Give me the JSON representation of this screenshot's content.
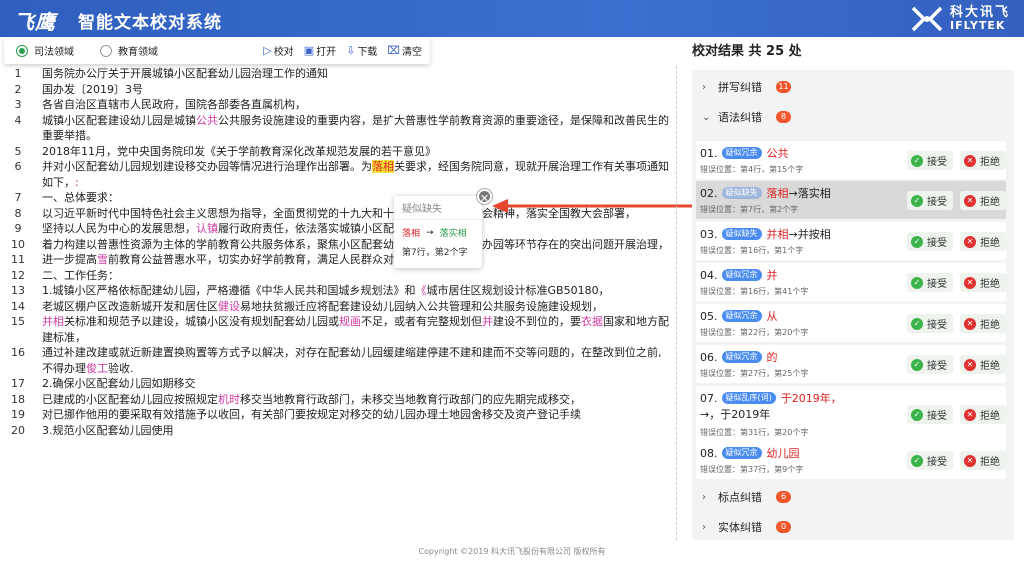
{
  "app": {
    "logo": "飞鹰",
    "title": "智能文本校对系统",
    "brand_cn": "科大讯飞",
    "brand_en": "IFLYTEK"
  },
  "toolbar": {
    "domain1": "司法领域",
    "domain2": "教育领域",
    "proofread": "校对",
    "open": "打开",
    "download": "下载",
    "clear": "清空"
  },
  "doc": {
    "lines": [
      {
        "n": "1",
        "html": "国务院办公厅关于开展城镇小区配套幼儿园治理工作的通知"
      },
      {
        "n": "2",
        "html": "国办发〔2019〕3号"
      },
      {
        "n": "3",
        "html": "各省自治区直辖市人民政府，国院各部委各直属机构，"
      },
      {
        "n": "4",
        "html": "城镇小区配套建设幼儿园是城镇<span class='p'>公共</span>公共服务设施建设的重要内容，是扩大普惠性学前教育资源的重要途径，是保障和改善民生的重要举措。"
      },
      {
        "n": "5",
        "html": "2018年11月，党中央国务院印发《关于学前教育深化改革规范发展的若干意见》"
      },
      {
        "n": "6",
        "html": "并对小区配套幼儿园规划建设移交办园等情况进行治理作出部署。为<span class='hl'>落相</span>关要求，经国务院同意，现就开展治理工作有关事项通知如下，<span class='r'>:</span>"
      },
      {
        "n": "7",
        "html": "一、总体要求："
      },
      {
        "n": "8",
        "html": "以习近平新时代中国特色社会主义思想为指导，全面贯彻党的十九大和十九届二中、三中全会精神，落实全国教大会部署，"
      },
      {
        "n": "9",
        "html": "坚持以人民为中心的发展思想，<span class='p'>认镇</span>履行政府责任，依法落实城镇小区配套幼儿园"
      },
      {
        "n": "10",
        "html": "着力构建以普惠性资源为主体的学前教育公共服务体系，聚焦小区配套幼儿园规划建设移交办园等环节存在的突出问题开展治理，"
      },
      {
        "n": "11",
        "html": "进一步提高<span class='p'>雪</span>前教育公益普惠水平，切实办好学前教育，满足人民群众对幼有所育的期盼。"
      },
      {
        "n": "12",
        "html": "二、工作任务："
      },
      {
        "n": "13",
        "html": "1.城镇小区严格依标配建幼儿园，严格遵循《中华人民共和国城乡规划法》和<span class='p'>《</span>城市居住区规划设计标准GB50180，"
      },
      {
        "n": "14",
        "html": "老城区棚户区改造新城开发和居住区<span class='p'>健设</span>易地扶贫搬迁应将配套建设幼儿园纳入公共管理和公共服务设施建设规划，"
      },
      {
        "n": "15",
        "html": "<span class='p'>并相</span>关标准和规范予以建设，城镇小区没有规划配套幼儿园或<span class='p'>规画</span>不足，或者有完整规划但<span class='p'>并</span>建设不到位的，要<span class='p'>衣据</span>国家和地方配建标准，"
      },
      {
        "n": "16",
        "html": "通过补建改建或就近新建置换购置等方式予以解决，对存在配套幼儿园缓建缩建停建不建和建而不交等问题的，在整改到位之前,不得办理<span class='p'>俊工</span>验收."
      },
      {
        "n": "17",
        "html": "2.确保小区配套幼儿园如期移交"
      },
      {
        "n": "18",
        "html": "已建成的小区配套幼儿园应按照规定<span class='p'>机时</span>移交当地教育行政部门，未移交当地教育行政部门的应先期完成移交，"
      },
      {
        "n": "19",
        "html": "对已挪作他用的要采取有效措施予以收回，有关部门要按规定对移交的幼儿园办理土地园舍移交及资产登记手续"
      },
      {
        "n": "20",
        "html": "3.规范小区配套幼儿园使用"
      }
    ]
  },
  "popup": {
    "title": "疑似缺失",
    "wrong": "落相",
    "arrow": "→",
    "right": "落实相",
    "pos": "第7行，第2个字"
  },
  "results": {
    "header": "校对结果 共 25 处",
    "sections": [
      {
        "label": "拼写纠错",
        "count": "11",
        "chev": "›"
      },
      {
        "label": "语法纠错",
        "count": "8",
        "chev": "⌄"
      },
      {
        "label": "标点纠错",
        "count": "6",
        "chev": "›"
      },
      {
        "label": "实体纠错",
        "count": "0",
        "chev": "›"
      }
    ],
    "accept": "接受",
    "reject": "拒绝",
    "items": [
      {
        "num": "01.",
        "tag": "疑似冗余",
        "wrong": "公共",
        "fix": "",
        "pos": "错误位置：第4行，第15个字"
      },
      {
        "num": "02.",
        "tag": "疑似缺失",
        "wrong": "落相",
        "fix": "→落实相",
        "pos": "错误位置：第7行，第2个字"
      },
      {
        "num": "03.",
        "tag": "疑似缺失",
        "wrong": "并相",
        "fix": "→并按相",
        "pos": "错误位置：第16行，第1个字"
      },
      {
        "num": "04.",
        "tag": "疑似冗余",
        "wrong": "并",
        "fix": "",
        "pos": "错误位置：第16行，第41个字"
      },
      {
        "num": "05.",
        "tag": "疑似冗余",
        "wrong": "从",
        "fix": "",
        "pos": "错误位置：第22行，第20个字"
      },
      {
        "num": "06.",
        "tag": "疑似冗余",
        "wrong": "的",
        "fix": "",
        "pos": "错误位置：第27行，第25个字"
      },
      {
        "num": "07.",
        "tag": "疑似乱序(词)",
        "wrong": "于2019年，",
        "fix": "→，于2019年",
        "pos": "错误位置：第31行，第20个字"
      },
      {
        "num": "08.",
        "tag": "疑似冗余",
        "wrong": "幼儿园",
        "fix": "",
        "pos": "错误位置：第37行，第9个字"
      }
    ]
  },
  "footer": "Copyright ©2019 科大讯飞股份有限公司 版权所有",
  "colors": {
    "header": "#3a6fd0",
    "accent_red": "#e02020",
    "pink": "#d23aa5",
    "green": "#2a9d4b",
    "tag_blue": "#4a8cf0",
    "badge": "#f2572b"
  }
}
